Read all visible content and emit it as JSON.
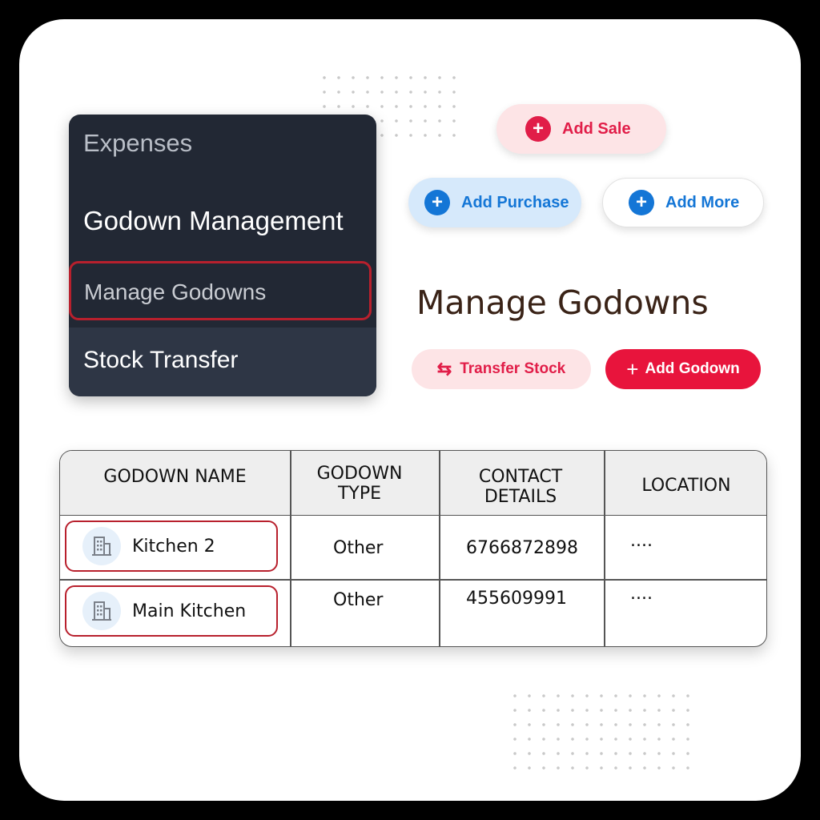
{
  "menu": {
    "expenses": "Expenses",
    "godown_management": "Godown Management",
    "manage_godowns": "Manage Godowns",
    "stock_transfer": "Stock Transfer"
  },
  "quick_actions": {
    "add_sale": "Add Sale",
    "add_purchase": "Add Purchase",
    "add_more": "Add More"
  },
  "page": {
    "title": "Manage Godowns",
    "transfer_stock": "Transfer Stock",
    "add_godown": "Add Godown"
  },
  "table": {
    "headers": [
      "GODOWN NAME",
      "GODOWN TYPE",
      "CONTACT DETAILS",
      "LOCATION"
    ],
    "rows": [
      {
        "name": "Kitchen 2",
        "type": "Other",
        "contact": "6766872898",
        "location": "...."
      },
      {
        "name": "Main Kitchen",
        "type": "Other",
        "contact": "455609991",
        "location": "...."
      }
    ]
  },
  "colors": {
    "accent_red": "#e11d48",
    "accent_blue": "#1476d6",
    "menu_bg": "#222834",
    "highlight_border": "#b8202d"
  },
  "icons": {
    "plus": "plus-circle-icon",
    "transfer": "transfer-arrows-icon",
    "building": "building-icon"
  }
}
